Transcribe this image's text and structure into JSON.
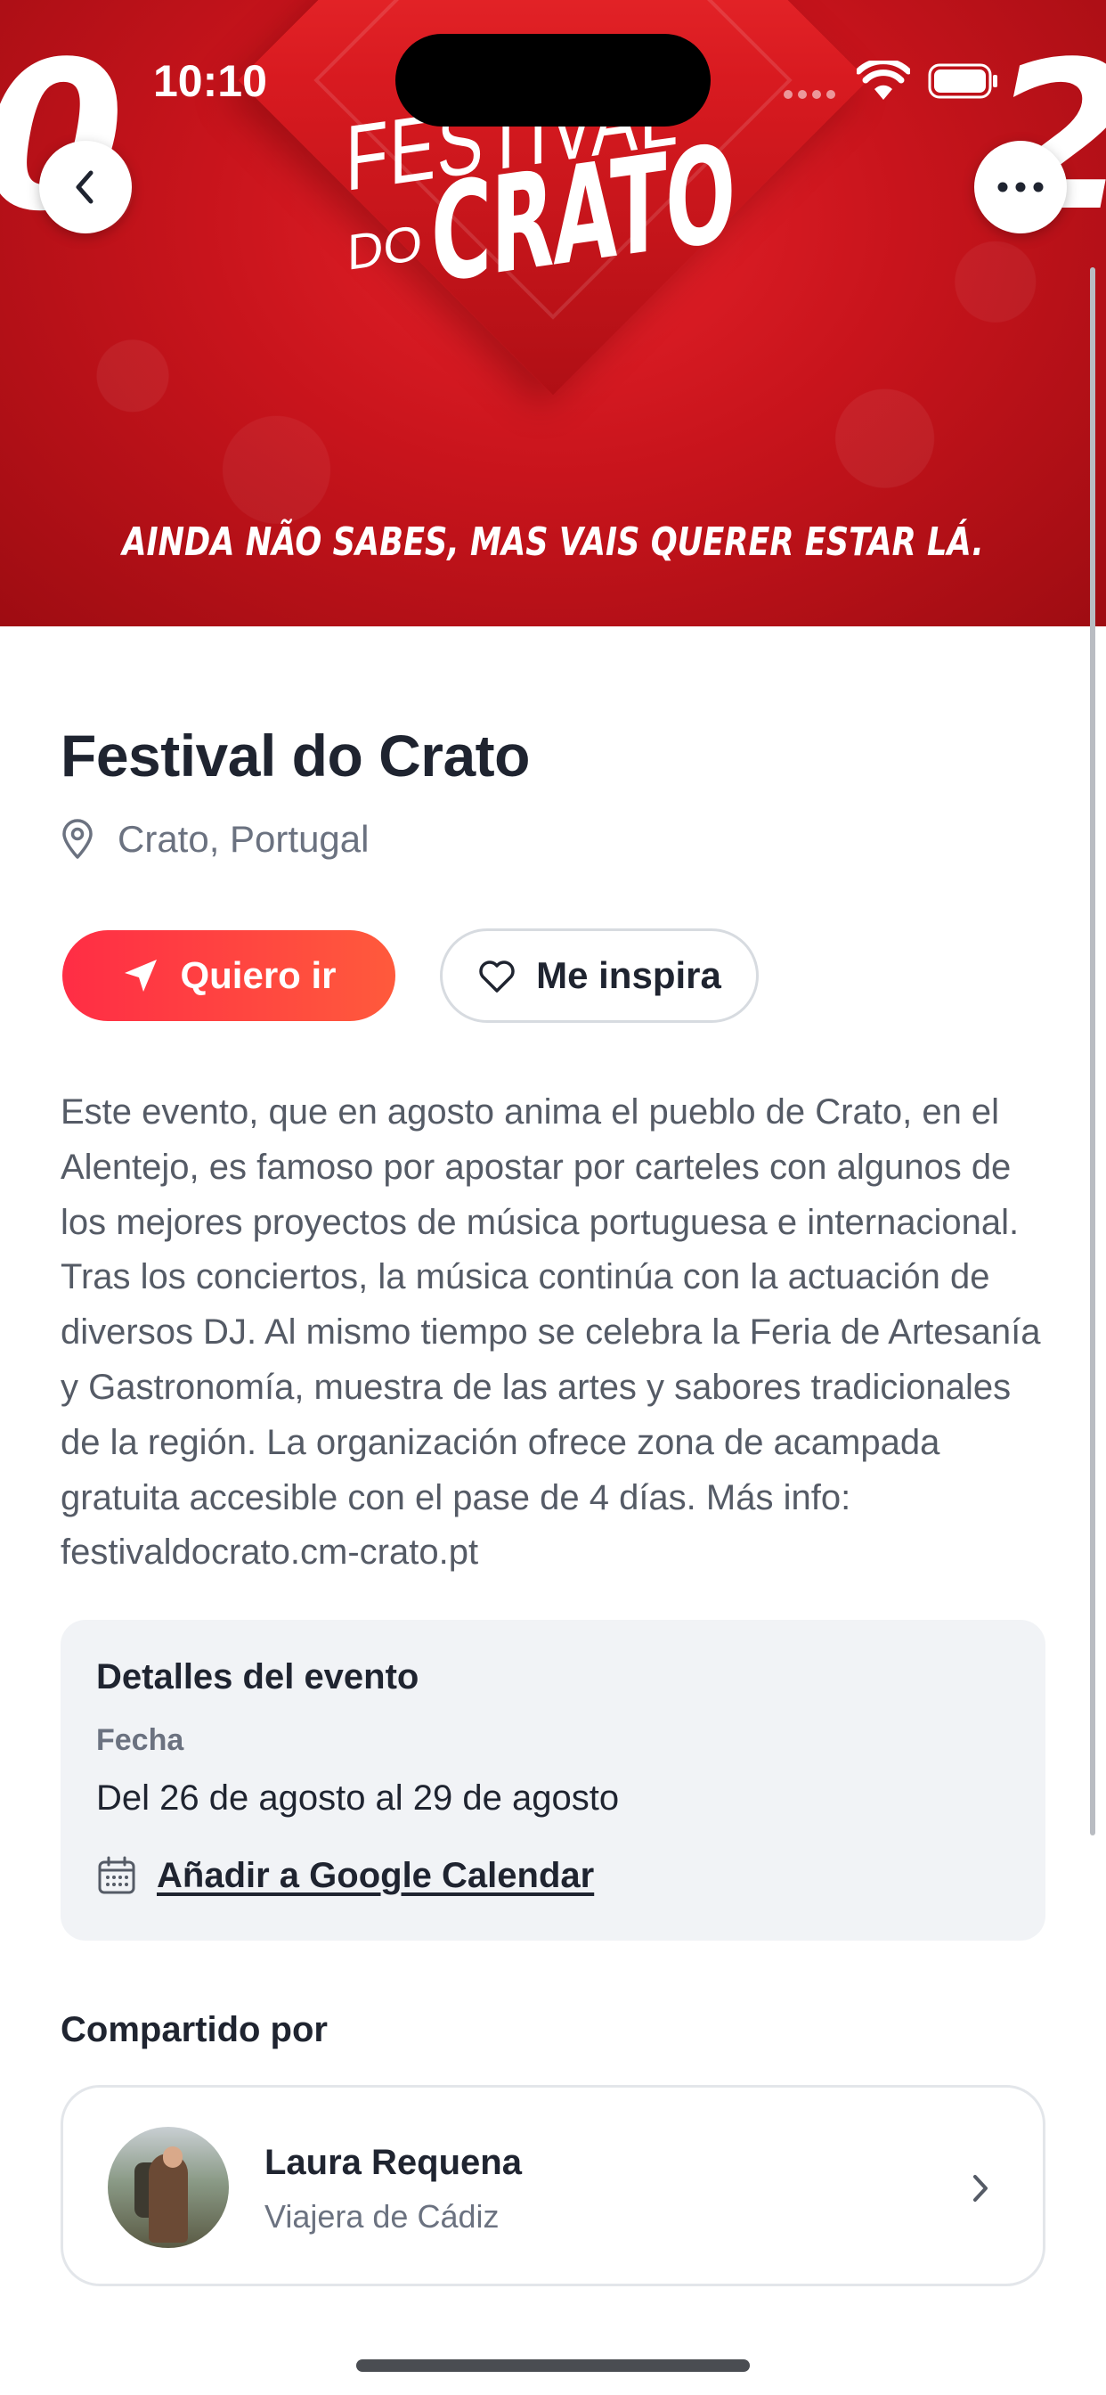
{
  "status_bar": {
    "time": "10:10"
  },
  "hero": {
    "logo_line1": "FESTIVAL",
    "logo_line2": "DO",
    "logo_line3": "CRATO",
    "tagline": "AINDA NÃO SABES, MAS VAIS QUERER ESTAR LÁ.",
    "big_left": "0",
    "big_right": "2",
    "background_color": "#d11a21"
  },
  "navigation": {
    "back_icon": "chevron-left-icon",
    "more_icon": "ellipsis-icon"
  },
  "event": {
    "title": "Festival do Crato",
    "location": "Crato, Portugal",
    "description": "Este evento, que en agosto anima el pueblo de Crato, en el Alentejo, es famoso por apostar por carteles con algunos de los mejores proyectos de música portuguesa e internacional. Tras los conciertos, la música continúa con la actuación de diversos DJ. Al mismo tiempo se celebra la Feria de Artesanía y Gastronomía, muestra de las artes y sabores tradicionales de la región. La organización ofrece zona de acampada gratuita accesible con el pase de 4 días. Más info: festivaldocrato.cm-crato.pt"
  },
  "actions": {
    "go_label": "Quiero ir",
    "inspire_label": "Me inspira",
    "accent_color": "#ff3344"
  },
  "details": {
    "title": "Detalles del evento",
    "date_label": "Fecha",
    "date_value": "Del 26 de agosto al 29 de agosto",
    "calendar_link": "Añadir a Google Calendar"
  },
  "shared_by": {
    "title": "Compartido por",
    "name": "Laura Requena",
    "subtitle": "Viajera de Cádiz"
  }
}
